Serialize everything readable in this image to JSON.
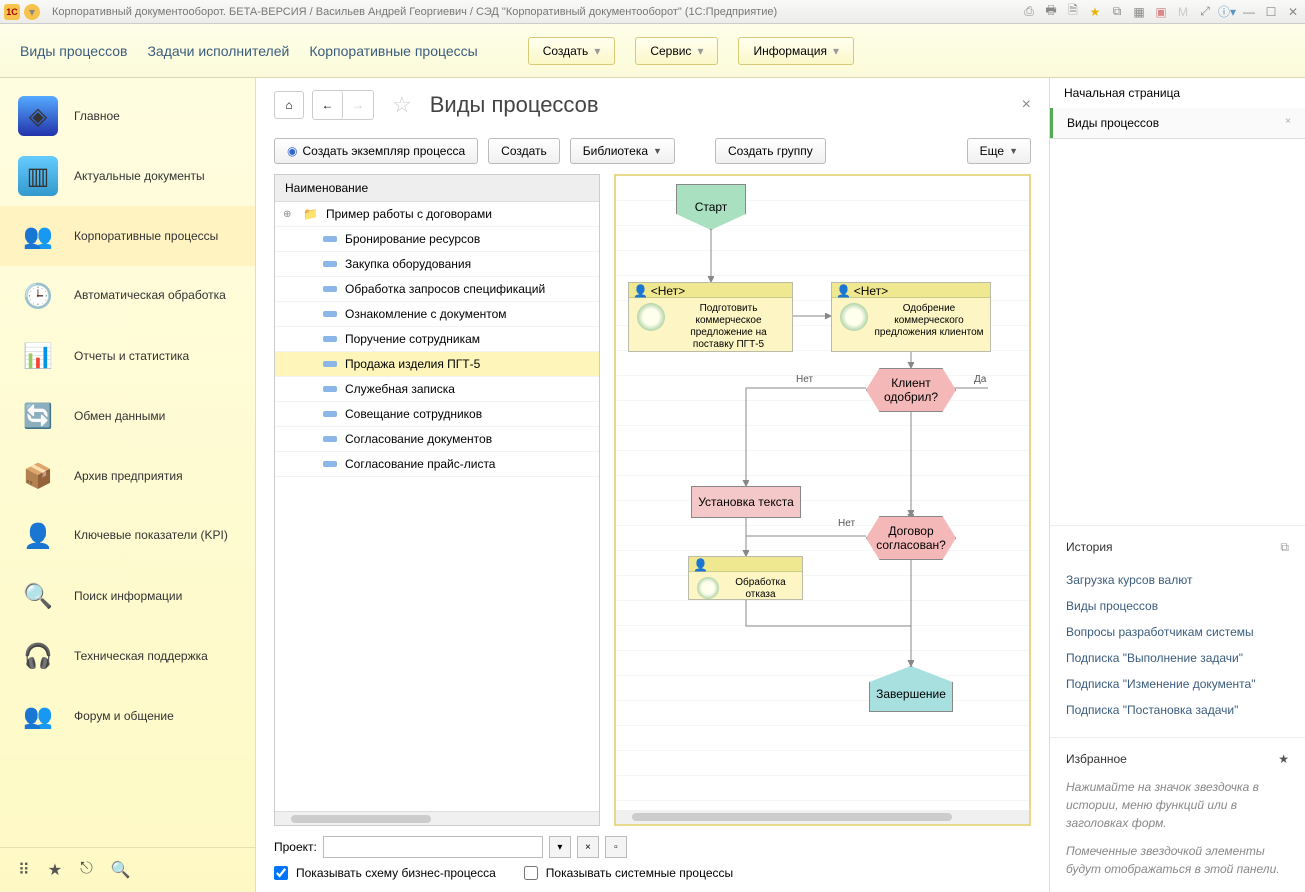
{
  "window_title": "Корпоративный документооборот. БЕТА-ВЕРСИЯ / Васильев Андрей Георгиевич / СЭД \"Корпоративный документооборот\"  (1С:Предприятие)",
  "toolbar": {
    "links": [
      "Виды процессов",
      "Задачи исполнителей",
      "Корпоративные процессы"
    ],
    "buttons": [
      "Создать",
      "Сервис",
      "Информация"
    ]
  },
  "sidebar": {
    "items": [
      "Главное",
      "Актуальные документы",
      "Корпоративные процессы",
      "Автоматическая обработка",
      "Отчеты и статистика",
      "Обмен данными",
      "Архив предприятия",
      "Ключевые показатели (KPI)",
      "Поиск информации",
      "Техническая поддержка",
      "Форум и общение"
    ],
    "selected_index": 2
  },
  "page": {
    "title": "Виды процессов",
    "cmd": {
      "create_instance": "Создать экземпляр процесса",
      "create": "Создать",
      "library": "Библиотека",
      "create_group": "Создать группу",
      "more": "Еще"
    },
    "tree": {
      "header": "Наименование",
      "folder": "Пример работы с договорами",
      "items": [
        "Бронирование ресурсов",
        "Закупка оборудования",
        "Обработка запросов спецификаций",
        "Ознакомление с документом",
        "Поручение сотрудникам",
        "Продажа изделия ПГТ-5",
        "Служебная записка",
        "Совещание сотрудников",
        "Согласование документов",
        "Согласование прайс-листа"
      ],
      "selected_index": 5
    },
    "diagram": {
      "start": "Старт",
      "task1_hdr": "<Нет>",
      "task1": "Подготовить коммерческое предложение на поставку ПГТ-5",
      "task2_hdr": "<Нет>",
      "task2": "Одобрение коммерческого предложения клиентом",
      "dec1": "Клиент одобрил?",
      "yes": "Да",
      "no": "Нет",
      "box1": "Установка текста",
      "dec2": "Договор согласован?",
      "task3": "Обработка отказа",
      "end": "Завершение"
    },
    "project_label": "Проект:",
    "chk1": "Показывать схему бизнес-процесса",
    "chk2": "Показывать системные процессы"
  },
  "rightpanel": {
    "tab1": "Начальная страница",
    "tab2": "Виды процессов",
    "history_title": "История",
    "history": [
      "Загрузка курсов валют",
      "Виды процессов",
      "Вопросы разработчикам системы",
      "Подписка \"Выполнение задачи\"",
      "Подписка \"Изменение документа\"",
      "Подписка \"Постановка задачи\""
    ],
    "fav_title": "Избранное",
    "fav_hint1": "Нажимайте на значок звездочка в истории, меню функций или в заголовках форм.",
    "fav_hint2": "Помеченные звездочкой элементы будут отображаться в этой панели."
  }
}
